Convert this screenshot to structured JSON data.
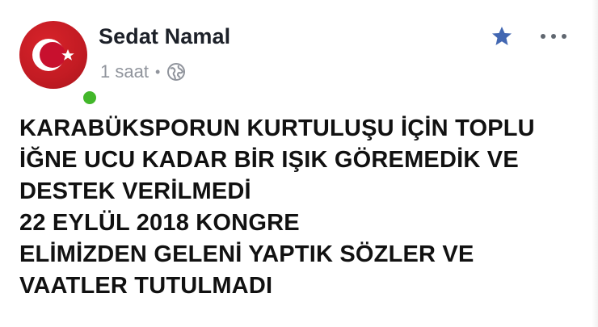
{
  "post": {
    "author": {
      "name": "Sedat Namal",
      "avatar_icon": "turkish-flag-crescent-star",
      "online": true,
      "online_color": "#42b72a",
      "avatar_color": "#c8102e"
    },
    "meta": {
      "time": "1 saat",
      "separator": "•",
      "privacy_icon": "globe-icon"
    },
    "actions": {
      "star_icon": "star-icon",
      "star_color": "#4267b2",
      "more_icon": "more-dots-icon"
    },
    "text_lines": [
      "KARABÜKSPORUN KURTULUŞU İÇİN TOPLU",
      "İĞNE UCU KADAR BİR IŞIK GÖREMEDİK VE",
      "DESTEK VERİLMEDİ",
      "22 EYLÜL 2018 KONGRE",
      "ELİMİZDEN GELENİ YAPTIK SÖZLER VE",
      "VAATLER TUTULMADI"
    ]
  }
}
